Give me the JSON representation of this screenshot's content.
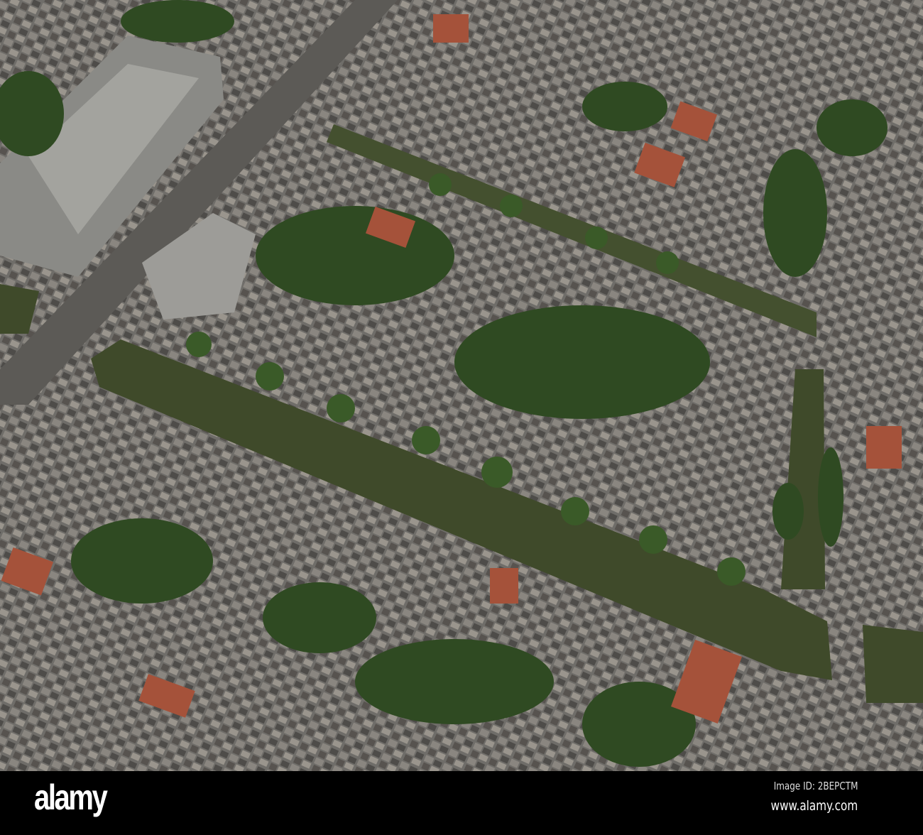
{
  "watermark": {
    "logo": "alamy",
    "image_id": "Image ID: 2BEPCTM",
    "website": "www.alamy.com"
  },
  "colors": {
    "rooftops": "#6f6d69",
    "canal": "#3f4a2a",
    "trees": "#2f4a22",
    "roof_red": "#a5523a",
    "bar": "#000000"
  }
}
